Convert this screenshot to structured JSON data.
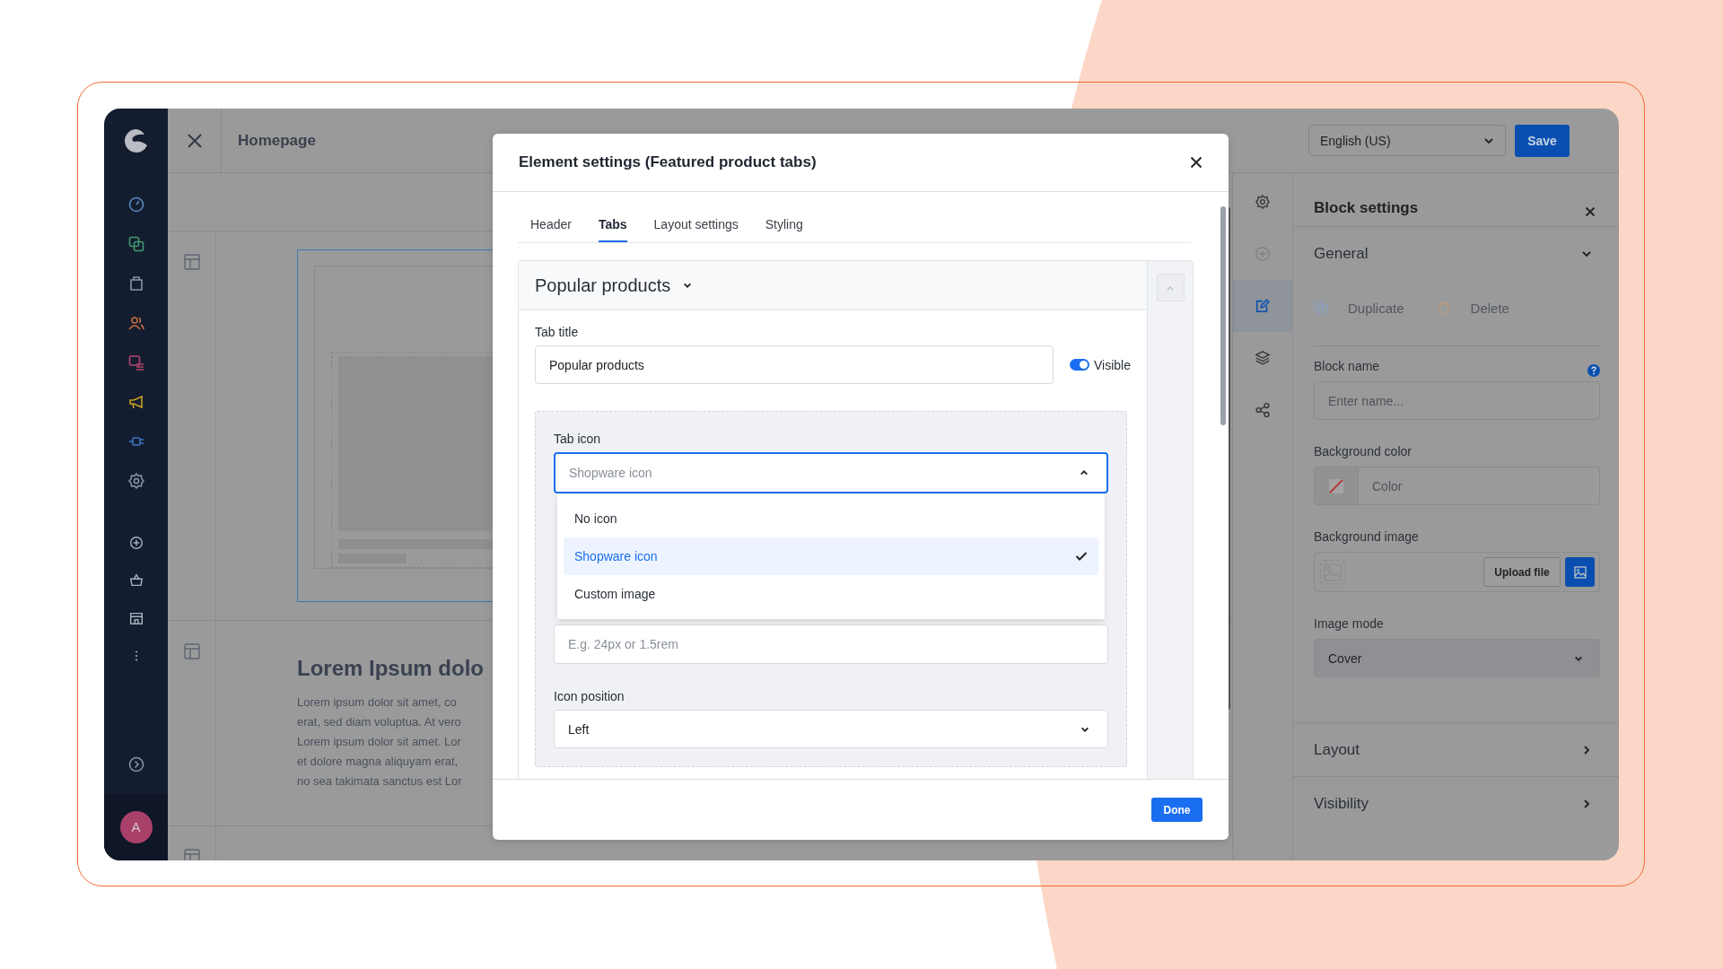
{
  "sidebar": {
    "avatar": "A"
  },
  "topbar": {
    "title": "Homepage",
    "language": "English (US)",
    "save_button": "Save"
  },
  "canvas": {
    "heading": "Lorem Ipsum dolo",
    "paragraph": "Lorem ipsum dolor sit amet, co\nerat, sed diam voluptua. At vero\nLorem ipsum dolor sit amet. Lor\net dolore magna aliquyam erat,\nno sea takimata sanctus est Lor"
  },
  "block_settings": {
    "title": "Block settings",
    "sections": [
      {
        "title": "General",
        "expanded": true
      },
      {
        "title": "Layout",
        "expanded": false
      },
      {
        "title": "Visibility",
        "expanded": false
      }
    ],
    "actions": [
      {
        "label": "Duplicate",
        "kind": "duplicate",
        "disabled": true
      },
      {
        "label": "Delete",
        "kind": "delete",
        "disabled": true
      }
    ],
    "block_name": {
      "label": "Block name",
      "placeholder": "Enter name..."
    },
    "background_color": {
      "label": "Background color",
      "placeholder": "Color"
    },
    "background_image": {
      "label": "Background image",
      "upload_button": "Upload file"
    },
    "image_mode": {
      "label": "Image mode",
      "value": "Cover"
    }
  },
  "modal": {
    "title": "Element settings (Featured product tabs)",
    "tabs": [
      {
        "label": "Header",
        "selected": false
      },
      {
        "label": "Tabs",
        "selected": true
      },
      {
        "label": "Layout settings",
        "selected": false
      },
      {
        "label": "Styling",
        "selected": false
      }
    ],
    "tab_panel": {
      "title": "Popular products",
      "tab_title": {
        "label": "Tab title",
        "value": "Popular products"
      },
      "visible": {
        "label": "Visible",
        "on": true
      },
      "tab_icon": {
        "label": "Tab icon",
        "placeholder": "Shopware icon",
        "open": true,
        "options": [
          {
            "label": "No icon",
            "selected": false
          },
          {
            "label": "Shopware icon",
            "selected": true
          },
          {
            "label": "Custom image",
            "selected": false
          }
        ]
      },
      "icon_size": {
        "placeholder": "E.g. 24px or 1.5rem"
      },
      "icon_position": {
        "label": "Icon position",
        "value": "Left"
      }
    },
    "done_button": "Done"
  }
}
